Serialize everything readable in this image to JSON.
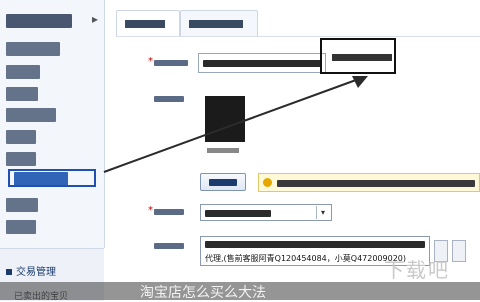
{
  "sidebar": {
    "items_count": 11,
    "bottom_section": {
      "title": "交易管理",
      "sub": "已卖出的宝贝"
    }
  },
  "tabs": [
    {
      "label": ""
    },
    {
      "label": ""
    }
  ],
  "form": {
    "description_line": "代理,(售前客服阿青Q120454084，小莫Q472009020)"
  },
  "watermark": "下载吧",
  "caption": "淘宝店怎么买么大法"
}
